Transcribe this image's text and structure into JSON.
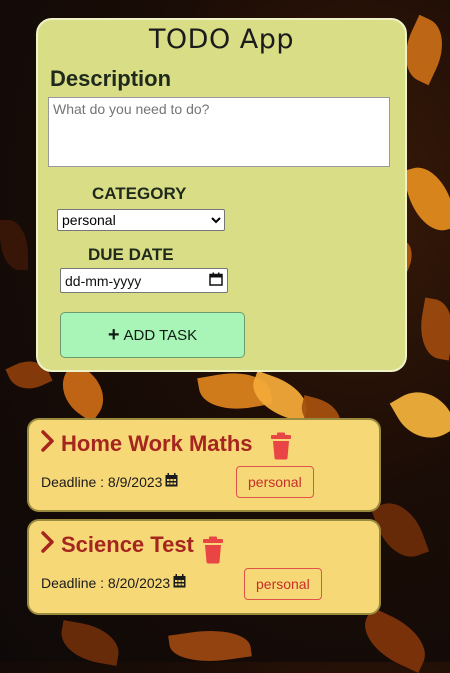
{
  "app": {
    "title": "TODO App"
  },
  "form": {
    "description_label": "Description",
    "description_placeholder": "What do you need to do?",
    "category_label": "CATEGORY",
    "category_selected": "personal",
    "due_date_label": "DUE DATE",
    "due_date_placeholder": "dd-mm-yyyy",
    "add_button_label": "ADD TASK"
  },
  "tasks": [
    {
      "title": "Home Work Maths",
      "deadline_text": "Deadline : 8/9/2023",
      "category": "personal"
    },
    {
      "title": "Science Test",
      "deadline_text": "Deadline : 8/20/2023",
      "category": "personal"
    }
  ],
  "colors": {
    "form_card": "#d8dd86",
    "add_button": "#a9f5b7",
    "task_card": "#f7d877",
    "task_title": "#a5261f",
    "trash_icon": "#e94545",
    "badge_border": "#e0534a"
  },
  "icons": {
    "add": "plus-icon",
    "expand": "chevron-right-icon",
    "delete": "trash-icon",
    "calendar": "calendar-icon"
  }
}
